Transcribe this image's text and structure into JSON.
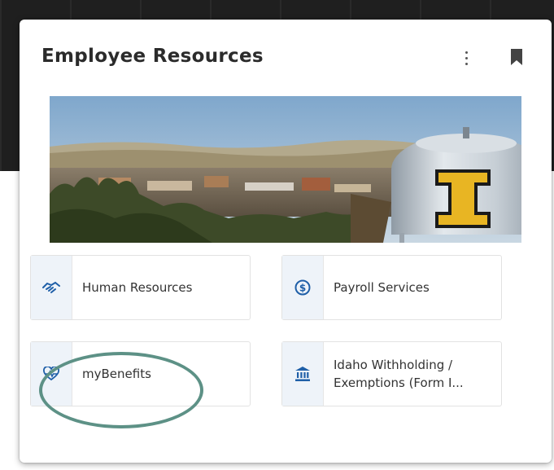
{
  "card": {
    "title": "Employee Resources",
    "menu_icon": "kebab-vertical-icon",
    "bookmark_icon": "bookmark-icon"
  },
  "banner": {
    "description_icon": "campus-water-tower-image"
  },
  "tiles": [
    {
      "label": "Human Resources",
      "icon": "handshake-icon"
    },
    {
      "label": "Payroll Services",
      "icon": "dollar-circle-icon"
    },
    {
      "label": "myBenefits",
      "icon": "heartbeat-icon"
    },
    {
      "label": "Idaho Withholding / Exemptions (Form I...",
      "icon": "bank-icon"
    }
  ],
  "colors": {
    "accent": "#1f5fa8",
    "annotation": "#5d9186",
    "tile_icon_bg": "#eef3f9"
  }
}
